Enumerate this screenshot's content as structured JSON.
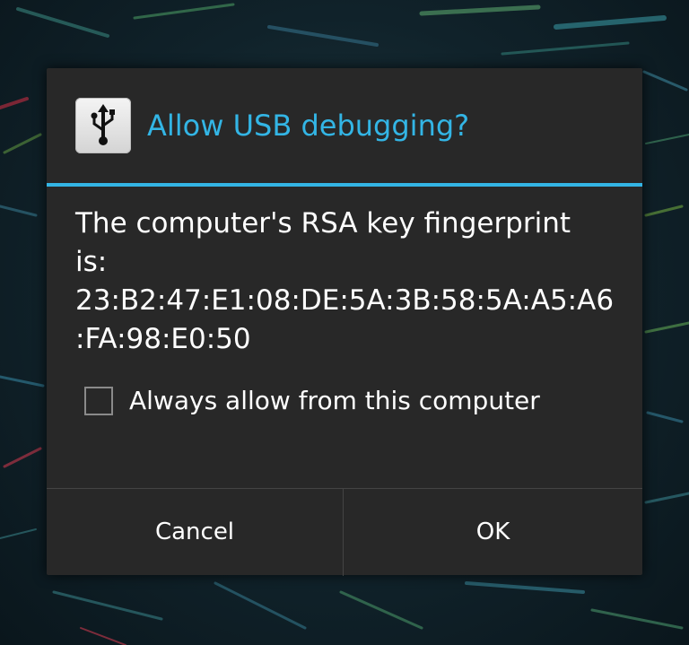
{
  "dialog": {
    "title": "Allow USB debugging?",
    "title_icon": "usb-icon",
    "message_lines": [
      "The computer's RSA key fingerprint",
      "is:",
      "23:B2:47:E1:08:DE:5A:3B:58:5A:A5:A6",
      ":FA:98:E0:50"
    ],
    "checkbox": {
      "label": "Always allow from this computer",
      "checked": false
    },
    "buttons": {
      "cancel": "Cancel",
      "ok": "OK"
    }
  },
  "colors": {
    "accent": "#33b5e5",
    "dialog_background": "#282828",
    "text": "#ffffff"
  }
}
